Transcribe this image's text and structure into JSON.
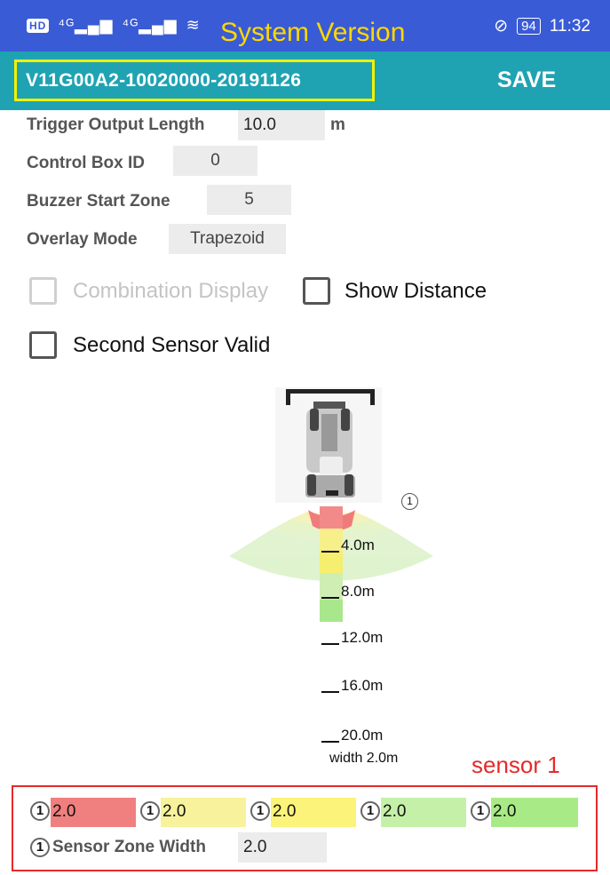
{
  "status_bar": {
    "left_icons": "HD 4G 4G wifi",
    "overlay_title": "System Version",
    "battery": "94",
    "time": "11:32"
  },
  "app_bar": {
    "version": "V11G00A2-10020000-20191126",
    "save_label": "SAVE"
  },
  "settings": {
    "trigger_output_length": {
      "label": "Trigger Output Length",
      "value": "10.0",
      "unit": "m"
    },
    "control_box_id": {
      "label": "Control Box ID",
      "value": "0"
    },
    "buzzer_start_zone": {
      "label": "Buzzer Start Zone",
      "value": "5"
    },
    "overlay_mode": {
      "label": "Overlay Mode",
      "value": "Trapezoid"
    }
  },
  "checkboxes": {
    "combination_display": {
      "label": "Combination Display",
      "checked": false,
      "enabled": false
    },
    "show_distance": {
      "label": "Show Distance",
      "checked": false,
      "enabled": true
    },
    "second_sensor_valid": {
      "label": "Second Sensor Valid",
      "checked": false,
      "enabled": true
    }
  },
  "diagram": {
    "sensor_badge": "1",
    "ticks": [
      "4.0m",
      "8.0m",
      "12.0m",
      "16.0m",
      "20.0m"
    ],
    "width_label": "width 2.0m",
    "colors": {
      "zone1": "#f07b7b",
      "zone2": "#f5ee6e",
      "zone3": "#f7f4b8",
      "zone4": "#d3f0b8",
      "zone5": "#a9e78c"
    }
  },
  "sensor_panel": {
    "title": "sensor 1",
    "zones": [
      {
        "badge": "1",
        "value": "2.0",
        "color": "#f07f7f"
      },
      {
        "badge": "1",
        "value": "2.0",
        "color": "#f7f29b"
      },
      {
        "badge": "1",
        "value": "2.0",
        "color": "#fbf37a"
      },
      {
        "badge": "1",
        "value": "2.0",
        "color": "#c5f0a8"
      },
      {
        "badge": "1",
        "value": "2.0",
        "color": "#a8eb86"
      }
    ],
    "zone_width": {
      "badge": "1",
      "label": "Sensor Zone Width",
      "value": "2.0"
    }
  }
}
